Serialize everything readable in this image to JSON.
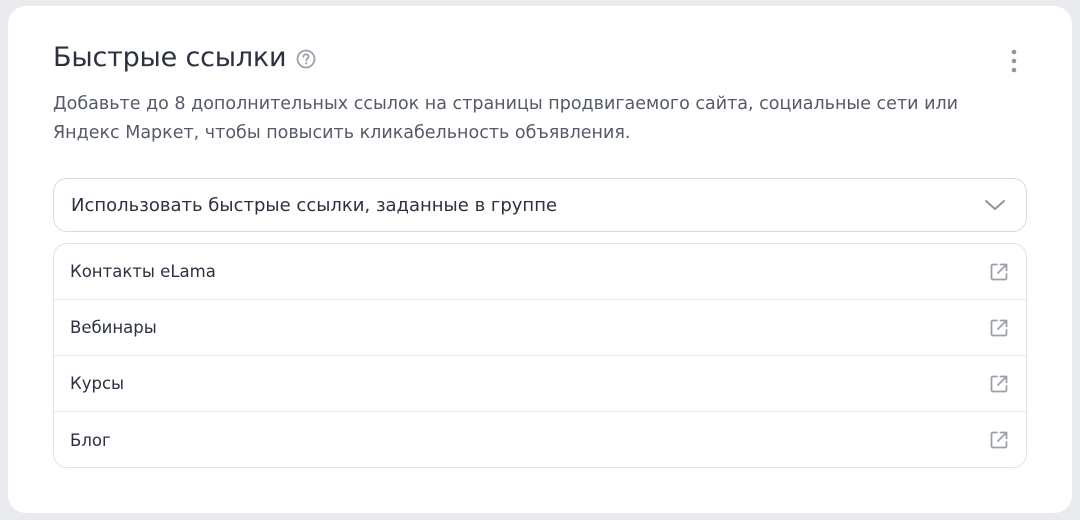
{
  "header": {
    "title": "Быстрые ссылки",
    "help_icon": "question-circle-icon",
    "more_icon": "more-vertical-icon"
  },
  "description": "Добавьте до 8 дополнительных ссылок на страницы продвигаемого сайта, социальные сети или Яндекс Маркет, чтобы повысить кликабельность объявления.",
  "select": {
    "value": "Использовать быстрые ссылки, заданные в группе",
    "icon": "chevron-down-icon"
  },
  "links": [
    {
      "label": "Контакты eLama",
      "icon": "external-link-icon"
    },
    {
      "label": "Вебинары",
      "icon": "external-link-icon"
    },
    {
      "label": "Курсы",
      "icon": "external-link-icon"
    },
    {
      "label": "Блог",
      "icon": "external-link-icon"
    }
  ],
  "colors": {
    "text": "#2b3140",
    "secondary_text": "#545a66",
    "icon": "#9ba0ab",
    "border": "#d8dbe1",
    "background": "#e9ebee",
    "card": "#ffffff"
  }
}
